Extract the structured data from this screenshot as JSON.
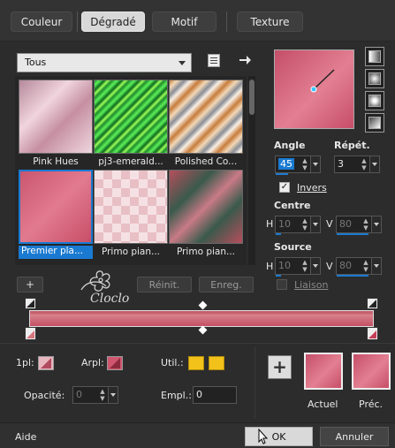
{
  "tabs": [
    {
      "label": "Couleur",
      "active": false
    },
    {
      "label": "Dégradé",
      "active": true
    },
    {
      "label": "Motif",
      "active": false
    },
    {
      "label": "Texture",
      "active": false
    }
  ],
  "category_select": {
    "value": "Tous"
  },
  "gradients": [
    {
      "label": "Pink Hues",
      "selected": false
    },
    {
      "label": "pj3-emerald...",
      "selected": false
    },
    {
      "label": "Polished Co...",
      "selected": false
    },
    {
      "label": "Premier pla...",
      "selected": true
    },
    {
      "label": "Primo pian...",
      "selected": false
    },
    {
      "label": "Primo pian...",
      "selected": false
    }
  ],
  "angle": {
    "label": "Angle",
    "value": "45"
  },
  "repeat": {
    "label": "Répét.",
    "value": "3"
  },
  "invert": {
    "label": "Invers",
    "checked": true
  },
  "center": {
    "label": "Centre",
    "h_label": "H",
    "h_value": "10",
    "v_label": "V",
    "v_value": "80"
  },
  "source": {
    "label": "Source",
    "h_label": "H",
    "h_value": "10",
    "v_label": "V",
    "v_value": "80"
  },
  "link": {
    "label": "Liaison"
  },
  "buttons": {
    "add": "+",
    "reset": "Réinit.",
    "save": "Enreg."
  },
  "stops": {
    "first_label": "1pl:",
    "arpl_label": "Arpl:",
    "util_label": "Util.:",
    "opacity_label": "Opacité:",
    "opacity_value": "0",
    "empl_label": "Empl.:",
    "empl_value": "0"
  },
  "preview": {
    "current_label": "Actuel",
    "previous_label": "Préc.",
    "add": "+"
  },
  "footer": {
    "help": "Aide",
    "ok": "OK",
    "cancel": "Annuler"
  },
  "watermark": "Cloclo",
  "colors": {
    "accent": "#1a7ad1",
    "gradient_start": "#d65d78",
    "gradient_end": "#c74f68",
    "util_yellow": "#f2c21a"
  }
}
